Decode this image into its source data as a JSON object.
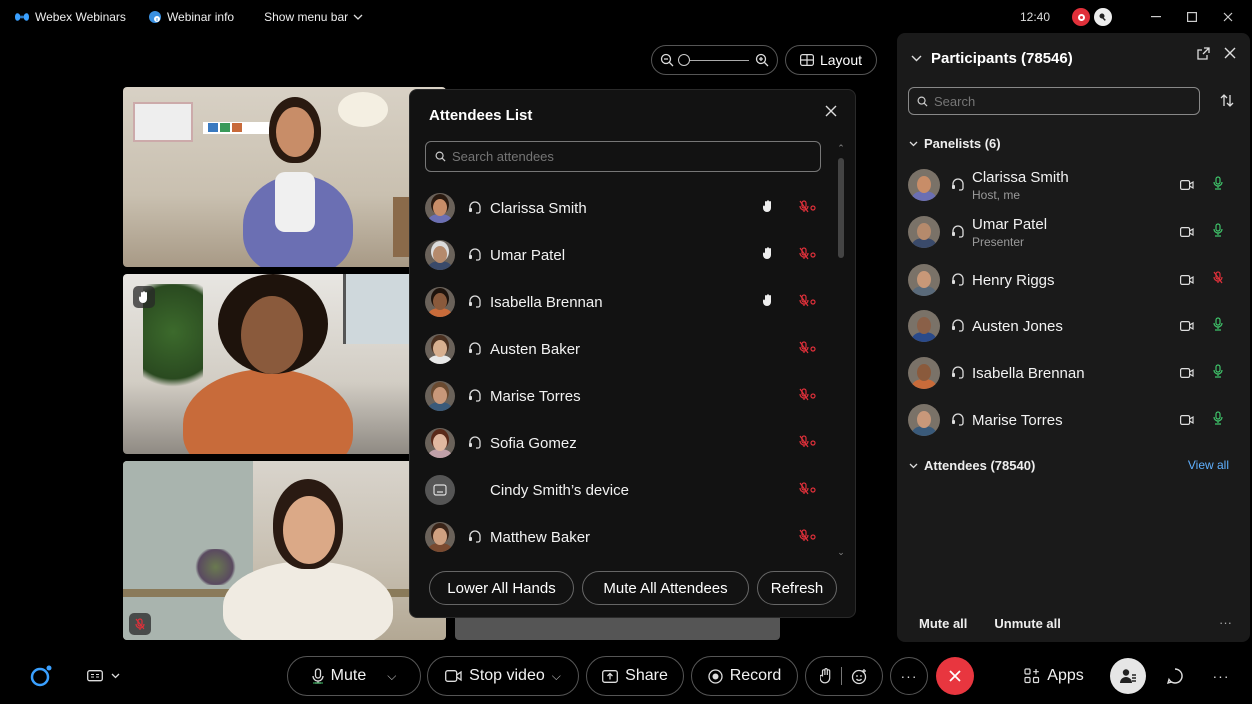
{
  "titlebar": {
    "app_name": "Webex Webinars",
    "webinar_info": "Webinar info",
    "show_menu_bar": "Show menu bar",
    "time": "12:40"
  },
  "stage": {
    "layout_label": "Layout"
  },
  "attendees_popup": {
    "title": "Attendees List",
    "search_placeholder": "Search attendees",
    "rows": [
      {
        "name": "Clarissa Smith",
        "hand": true,
        "skin": "#c88d68",
        "hair": "#2a1a10",
        "shirt": "#6b6fb3"
      },
      {
        "name": "Umar Patel",
        "hand": true,
        "skin": "#b58a6c",
        "hair": "#dcdcdc",
        "shirt": "#3a4a6a"
      },
      {
        "name": "Isabella Brennan",
        "hand": true,
        "skin": "#8a5a3c",
        "hair": "#1e130c",
        "shirt": "#c86b3a"
      },
      {
        "name": "Austen Baker",
        "hand": false,
        "skin": "#d8b090",
        "hair": "#4a3020",
        "shirt": "#e8e8e8"
      },
      {
        "name": "Marise Torres",
        "hand": false,
        "skin": "#c8987a",
        "hair": "#6a4a30",
        "shirt": "#3a5a7a"
      },
      {
        "name": "Sofia Gomez",
        "hand": false,
        "skin": "#e0b8a0",
        "hair": "#5a2a1a",
        "shirt": "#c0a0a8"
      },
      {
        "name": "Cindy Smith’s device",
        "hand": false,
        "device": true
      },
      {
        "name": "Matthew Baker",
        "hand": false,
        "skin": "#d0a080",
        "hair": "#3a2418",
        "shirt": "#7a4a30"
      }
    ],
    "buttons": {
      "lower_hands": "Lower All Hands",
      "mute_all": "Mute All Attendees",
      "refresh": "Refresh"
    }
  },
  "participants_panel": {
    "title": "Participants (78546)",
    "search_placeholder": "Search",
    "panelists_header": "Panelists (6)",
    "attendees_header": "Attendees (78540)",
    "view_all": "View all",
    "mute_all": "Mute all",
    "unmute_all": "Unmute all",
    "more": "···",
    "panelists": [
      {
        "name": "Clarissa Smith",
        "role": "Host, me",
        "muted": false,
        "skin": "#c88d68",
        "shirt": "#6b6fb3"
      },
      {
        "name": "Umar Patel",
        "role": "Presenter",
        "muted": false,
        "skin": "#b58a6c",
        "shirt": "#3a4a6a"
      },
      {
        "name": "Henry Riggs",
        "role": "",
        "muted": true,
        "skin": "#c89878",
        "shirt": "#5a6a7a"
      },
      {
        "name": "Austen Jones",
        "role": "",
        "muted": false,
        "skin": "#8a6048",
        "shirt": "#2a4a8a"
      },
      {
        "name": "Isabella Brennan",
        "role": "",
        "muted": false,
        "skin": "#8a5a3c",
        "shirt": "#c86b3a"
      },
      {
        "name": "Marise Torres",
        "role": "",
        "muted": false,
        "skin": "#c8987a",
        "shirt": "#3a5a7a"
      }
    ]
  },
  "bottombar": {
    "mute": "Mute",
    "stop_video": "Stop video",
    "share": "Share",
    "record": "Record",
    "apps": "Apps",
    "more": "···"
  },
  "colors": {
    "accent_blue": "#5fb0ff",
    "mic_green": "#3fc46a",
    "mute_red": "#e0303a",
    "end_red": "#e8363f"
  }
}
